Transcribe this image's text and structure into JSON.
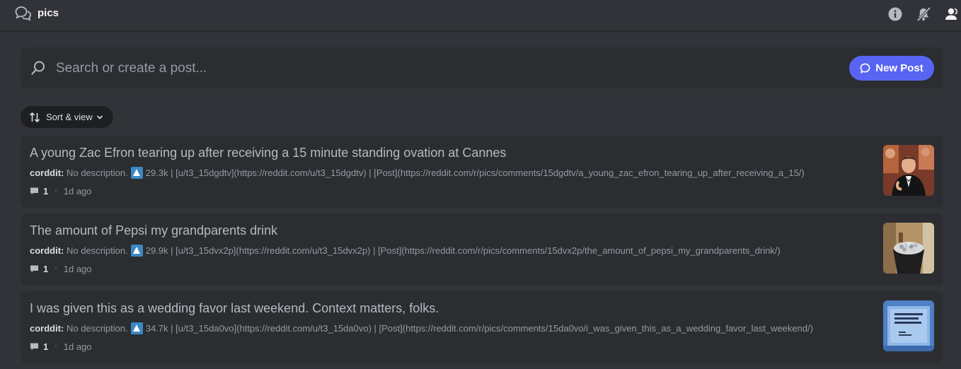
{
  "header": {
    "title": "pics",
    "icons": [
      "forum-icon",
      "info-icon",
      "bell-slash-icon",
      "members-icon"
    ]
  },
  "search": {
    "placeholder": "Search or create a post...",
    "new_post_label": "New Post"
  },
  "sort": {
    "label": "Sort & view"
  },
  "colors": {
    "accent": "#5865f2",
    "upvote": "#3b88c3",
    "background": "#313338",
    "card": "#2b2d31"
  },
  "posts": [
    {
      "title": "A young Zac Efron tearing up after receiving a 15 minute standing ovation at Cannes",
      "author": "corddit:",
      "description": "No description.",
      "details": "29.3k | [u/t3_15dgdtv](https://reddit.com/u/t3_15dgdtv) | [Post](https://reddit.com/r/pics/comments/15dgdtv/a_young_zac_efron_tearing_up_after_receiving_a_15/)",
      "comments": "1",
      "time": "1d ago"
    },
    {
      "title": "The amount of Pepsi my grandparents drink",
      "author": "corddit:",
      "description": "No description.",
      "details": "29.9k | [u/t3_15dvx2p](https://reddit.com/u/t3_15dvx2p) | [Post](https://reddit.com/r/pics/comments/15dvx2p/the_amount_of_pepsi_my_grandparents_drink/)",
      "comments": "1",
      "time": "1d ago"
    },
    {
      "title": "I was given this as a wedding favor last weekend. Context matters, folks.",
      "author": "corddit:",
      "description": "No description.",
      "details": "34.7k | [u/t3_15da0vo](https://reddit.com/u/t3_15da0vo) | [Post](https://reddit.com/r/pics/comments/15da0vo/i_was_given_this_as_a_wedding_favor_last_weekend/)",
      "comments": "1",
      "time": "1d ago"
    }
  ]
}
